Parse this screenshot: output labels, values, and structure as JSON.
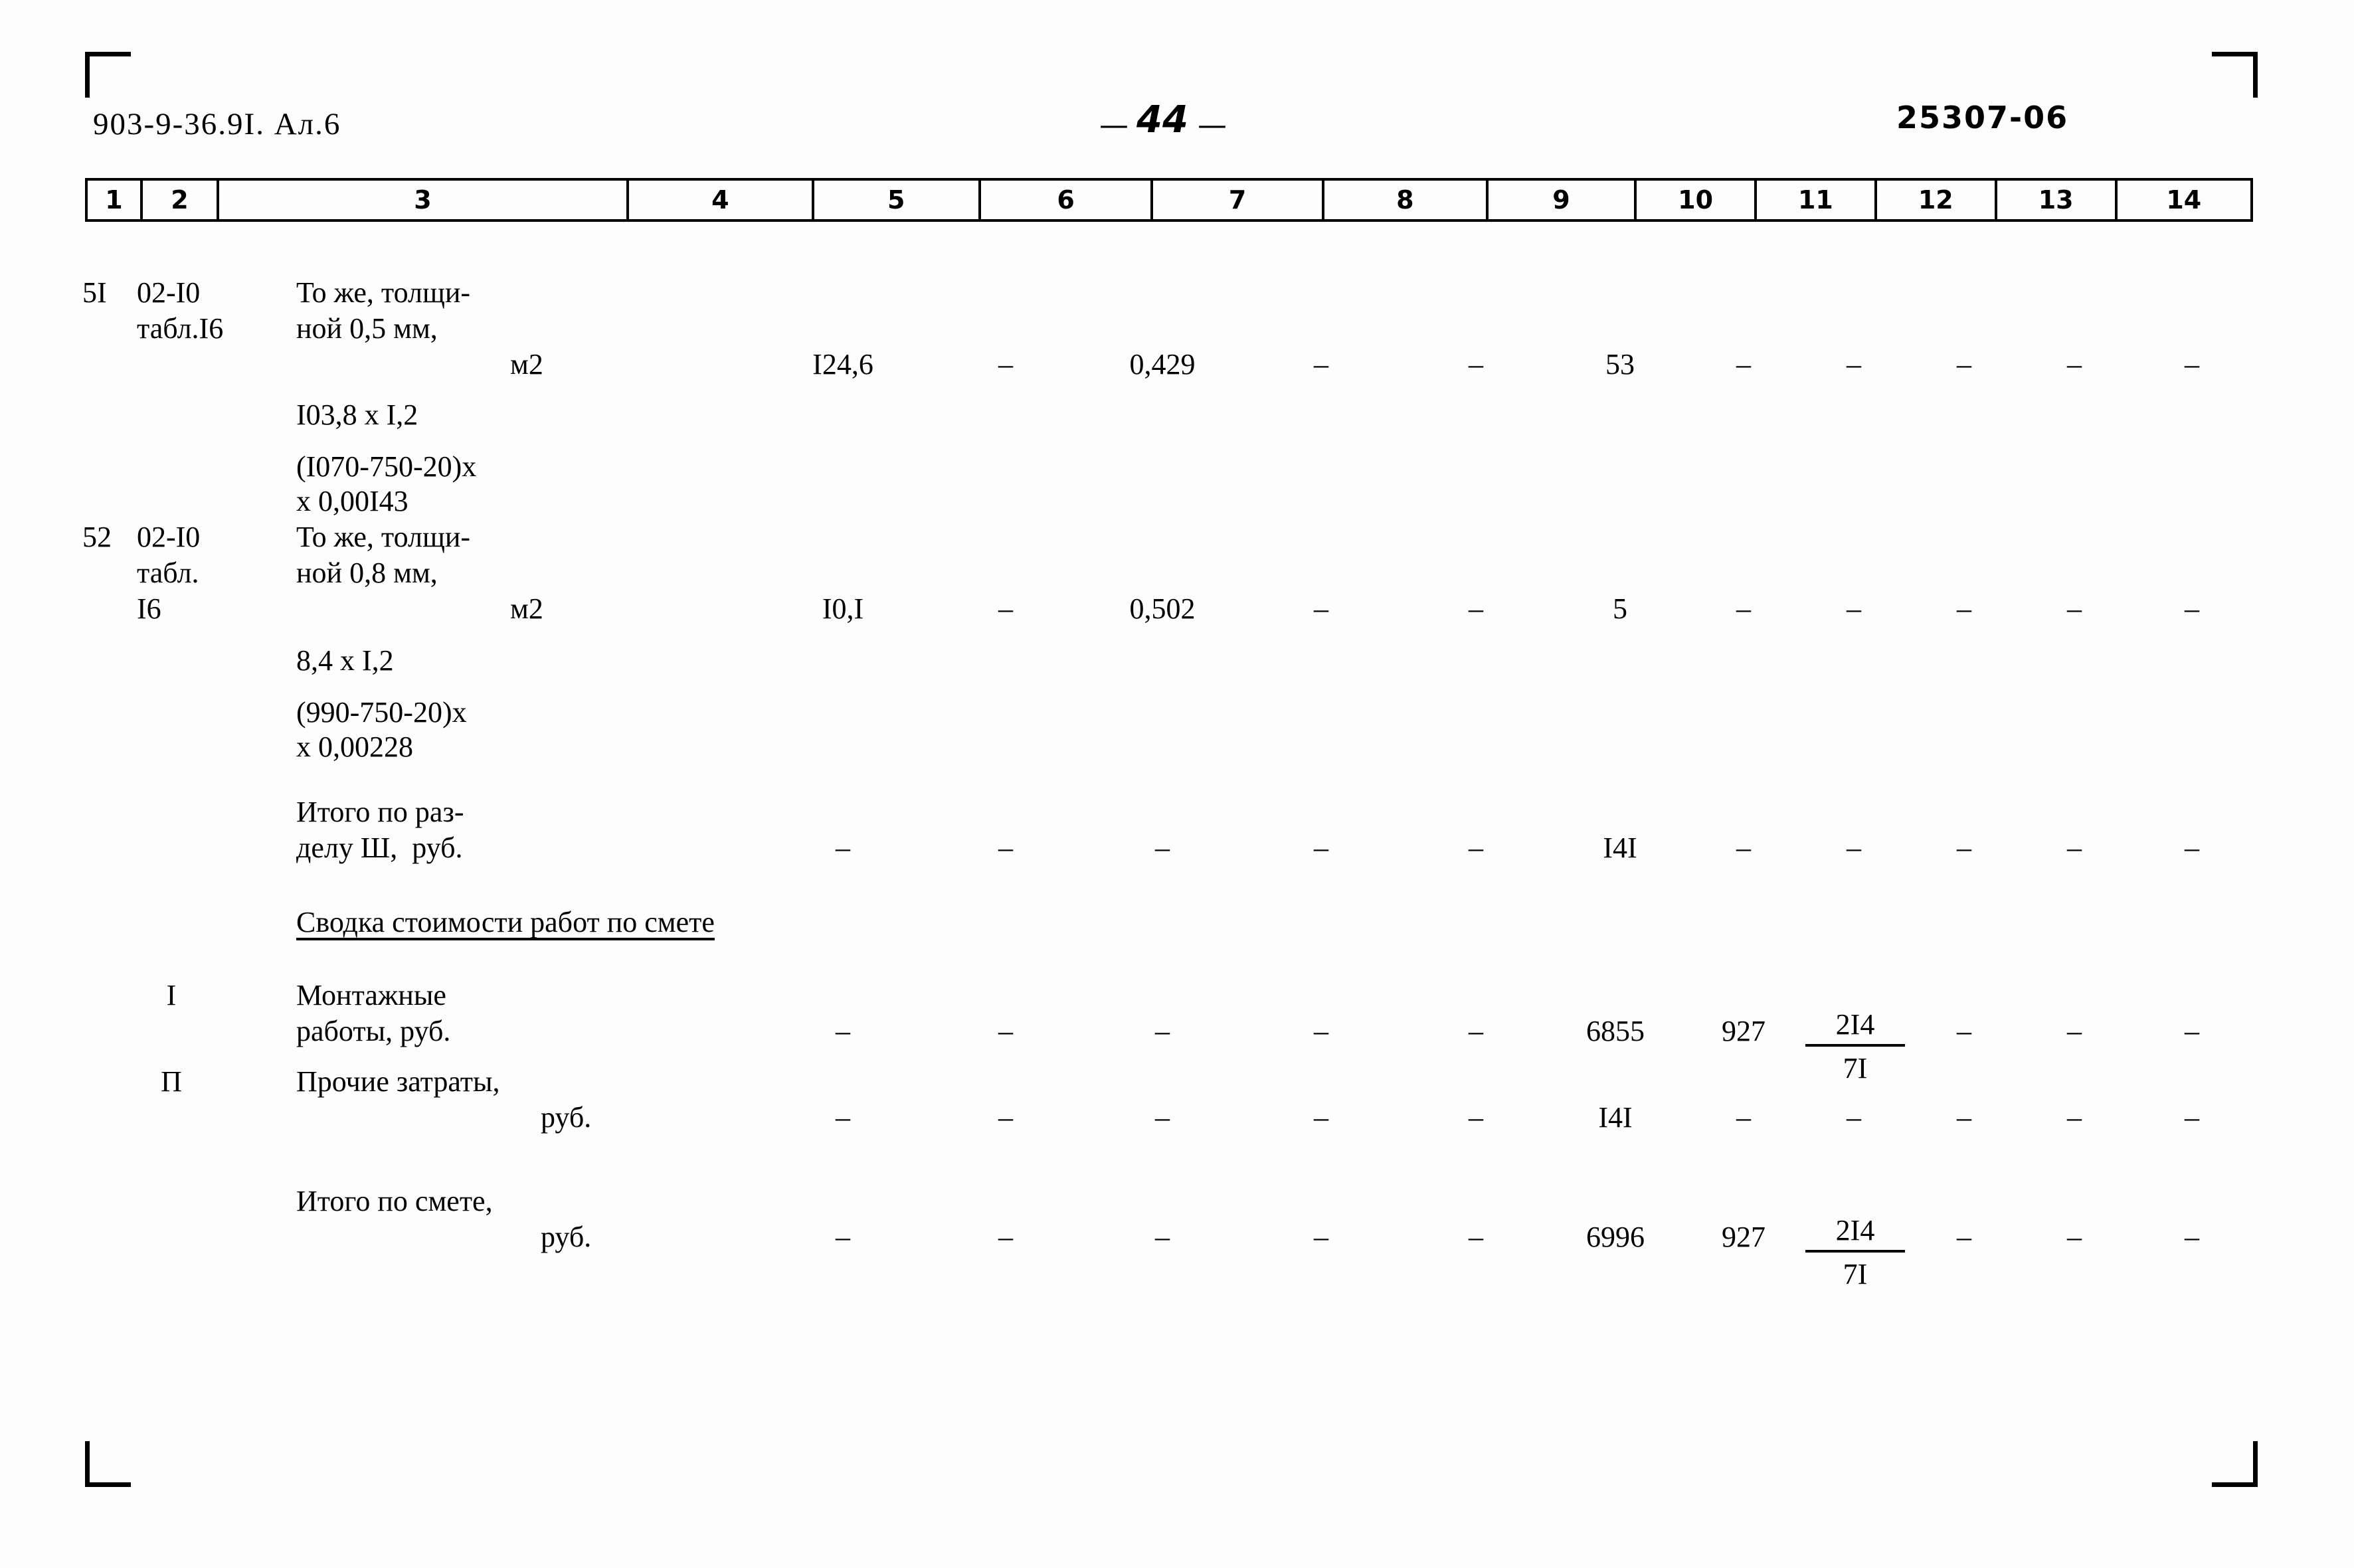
{
  "header": {
    "doc_code": "903-9-36.9I. Ал.6",
    "page_number": "44",
    "page_dash_left": "—",
    "page_dash_right": "—",
    "stamp_code": "25307-06"
  },
  "table": {
    "column_headers": [
      "1",
      "2",
      "3",
      "4",
      "5",
      "6",
      "7",
      "8",
      "9",
      "10",
      "11",
      "12",
      "13",
      "14"
    ],
    "dash": "–",
    "rows": [
      {
        "name": "row-51",
        "col1": "5I",
        "col2_lines": [
          "02-I0",
          "табл.I6"
        ],
        "col3_lines": [
          "То же, толщи-",
          "ной 0,5 мм,",
          "м2"
        ],
        "col3_formula": [
          "I03,8 x I,2",
          "(I070-750-20)x",
          "x 0,00I43"
        ],
        "col4": "I24,6",
        "col5": "–",
        "col6": "0,429",
        "col7": "–",
        "col8": "–",
        "col9": "53",
        "col10": "–",
        "col11": "–",
        "col12": "–",
        "col13": "–",
        "col14": "–"
      },
      {
        "name": "row-52",
        "col1": "52",
        "col2_lines": [
          "02-I0",
          "табл.",
          "I6"
        ],
        "col3_lines": [
          "То же, толщи-",
          "ной 0,8 мм,",
          "м2"
        ],
        "col3_formula": [
          "8,4 x I,2",
          "(990-750-20)x",
          "x 0,00228"
        ],
        "col4": "I0,I",
        "col5": "–",
        "col6": "0,502",
        "col7": "–",
        "col8": "–",
        "col9": "5",
        "col10": "–",
        "col11": "–",
        "col12": "–",
        "col13": "–",
        "col14": "–"
      },
      {
        "name": "row-section-total",
        "col1": "",
        "col2_lines": [],
        "col3_lines": [
          "Итого по раз-",
          "делу Ш,  руб."
        ],
        "col3_formula": [],
        "col4": "–",
        "col5": "–",
        "col6": "–",
        "col7": "–",
        "col8": "–",
        "col9": "I4I",
        "col10": "–",
        "col11": "–",
        "col12": "–",
        "col13": "–",
        "col14": "–"
      }
    ],
    "section_heading": "Сводка стоимости работ по смете",
    "summary_rows": [
      {
        "name": "row-montage",
        "col2": "I",
        "col3_lines": [
          "Монтажные",
          "работы, руб."
        ],
        "col4": "–",
        "col5": "–",
        "col6": "–",
        "col7": "–",
        "col8": "–",
        "col9": "6855",
        "col10": "927",
        "col11_numerator": "2I4",
        "col11_denominator": "7I",
        "col12": "–",
        "col13": "–",
        "col14": "–"
      },
      {
        "name": "row-other-costs",
        "col2": "П",
        "col3_lines": [
          "Прочие затраты,",
          "руб."
        ],
        "col4": "–",
        "col5": "–",
        "col6": "–",
        "col7": "–",
        "col8": "–",
        "col9": "I4I",
        "col10": "–",
        "col11_numerator": "",
        "col11_denominator": "",
        "col11_plain": "–",
        "col12": "–",
        "col13": "–",
        "col14": "–"
      },
      {
        "name": "row-grand-total",
        "col2": "",
        "col3_lines": [
          "Итого по смете,",
          "руб."
        ],
        "col4": "–",
        "col5": "–",
        "col6": "–",
        "col7": "–",
        "col8": "–",
        "col9": "6996",
        "col10": "927",
        "col11_numerator": "2I4",
        "col11_denominator": "7I",
        "col12": "–",
        "col13": "–",
        "col14": "–"
      }
    ]
  }
}
